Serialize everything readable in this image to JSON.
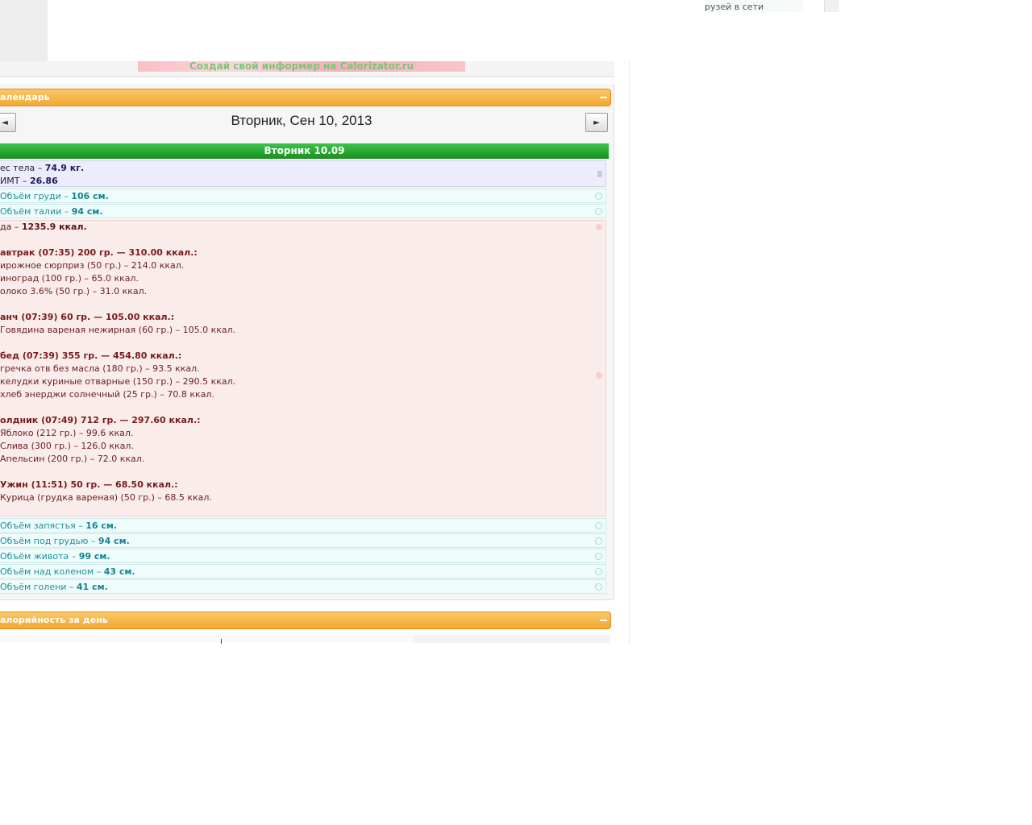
{
  "top": {
    "friends_text": "рузей в сети",
    "informer_text": "Создай свой информер на Calorizator.ru"
  },
  "calendar": {
    "title": "алендарь",
    "date_title": "Вторник, Сен 10, 2013",
    "prev_label": "◄",
    "next_label": "►",
    "day_label": "Вторник  10.09"
  },
  "weight": {
    "label1": "ес тела – ",
    "value1": "74.9 кг.",
    "label2": "ИМТ – ",
    "value2": "26.86"
  },
  "measurements_top": [
    {
      "label": "Объём груди – ",
      "value": "106 см."
    },
    {
      "label": "Объём талии – ",
      "value": "94 см."
    }
  ],
  "food": {
    "summary_label": "да – ",
    "summary_value": "1235.9 ккал.",
    "lines": [
      {
        "type": "meal",
        "text": "автрак (07:35) 200 гр. — 310.00 ккал.:"
      },
      {
        "type": "item",
        "text": "ирожное сюрприз (50 гр.) – 214.0 ккал."
      },
      {
        "type": "item",
        "text": "иноград (100 гр.) – 65.0 ккал."
      },
      {
        "type": "item",
        "text": "олоко 3.6% (50 гр.) – 31.0 ккал."
      },
      {
        "type": "meal",
        "text": "анч (07:39) 60 гр. — 105.00 ккал.:"
      },
      {
        "type": "item",
        "text": "Говядина вареная нежирная (60 гр.) – 105.0 ккал."
      },
      {
        "type": "meal",
        "text": "бед (07:39) 355 гр. — 454.80 ккал.:"
      },
      {
        "type": "item",
        "text": "гречка отв без масла (180 гр.) – 93.5 ккал."
      },
      {
        "type": "item",
        "text": "келудки куриные отварные (150 гр.) – 290.5 ккал."
      },
      {
        "type": "item",
        "text": "хлеб энерджи солнечный (25 гр.) – 70.8 ккал."
      },
      {
        "type": "meal",
        "text": "олдник (07:49) 712 гр. — 297.60 ккал.:"
      },
      {
        "type": "item",
        "text": "Яблоко (212 гр.) – 99.6 ккал."
      },
      {
        "type": "item",
        "text": "Слива (300 гр.) – 126.0 ккал."
      },
      {
        "type": "item",
        "text": "Апельсин (200 гр.) – 72.0 ккал."
      },
      {
        "type": "meal",
        "text": "Ужин (11:51) 50 гр. — 68.50 ккал.:"
      },
      {
        "type": "item",
        "text": "Курица (грудка вареная) (50 гр.) – 68.5 ккал."
      }
    ]
  },
  "measurements_bottom": [
    {
      "label": "Объём запястья – ",
      "value": "16 см."
    },
    {
      "label": "Объём под грудью – ",
      "value": "94 см."
    },
    {
      "label": "Объём живота – ",
      "value": "99 см."
    },
    {
      "label": "Объём над коленом – ",
      "value": "43 см."
    },
    {
      "label": "Объём голени – ",
      "value": "41 см."
    }
  ],
  "calorie_section": {
    "title": "алорийность за день"
  }
}
